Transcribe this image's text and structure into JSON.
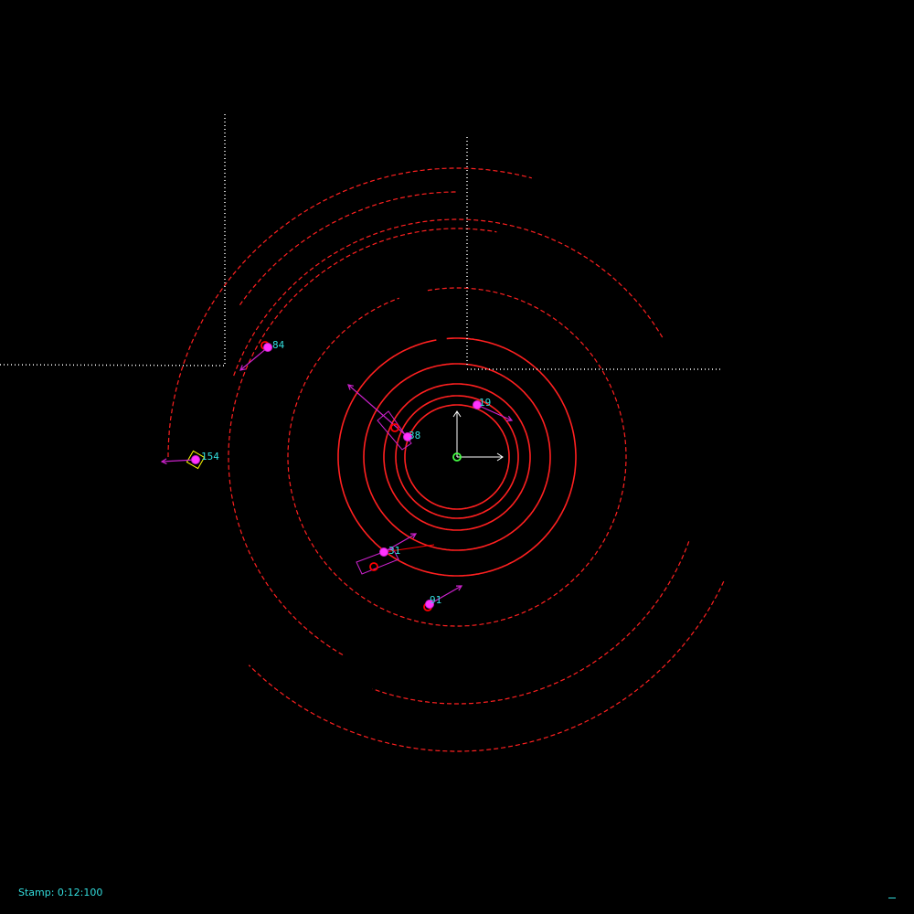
{
  "colors": {
    "background": "#000000",
    "rings": "#ff2020",
    "walls": "#ffffff",
    "track_box": "#cc22cc",
    "track_point": "#ff33ff",
    "detection": "#ff0000",
    "label": "#33dddd",
    "ego": "#44ff44",
    "axis": "#ffffff",
    "highlight_box": "#ffff00"
  },
  "status": {
    "stamp_text": "Stamp: 0:12:100"
  },
  "tracks": [
    {
      "id": "84"
    },
    {
      "id": "19"
    },
    {
      "id": "38"
    },
    {
      "id": "154"
    },
    {
      "id": "31"
    },
    {
      "id": "91"
    }
  ]
}
